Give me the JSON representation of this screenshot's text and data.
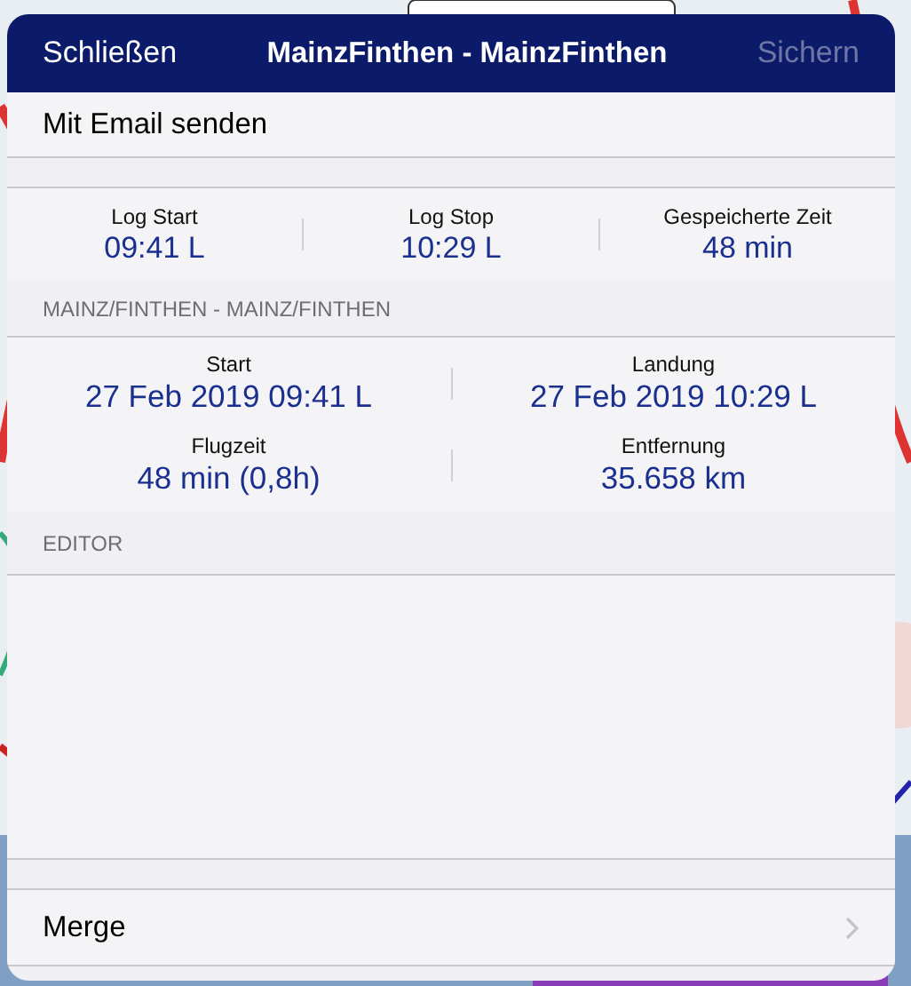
{
  "nav_bar": {
    "left_button": {
      "label": "Schließen",
      "disabled": false
    },
    "title": "MainzFinthen - MainzFinthen",
    "right_button": {
      "label": "Sichern",
      "disabled": true
    }
  },
  "actions": [
    {
      "label": "Mit Email senden"
    }
  ],
  "log_stats": [
    {
      "label": "Log Start",
      "value": "09:41 L"
    },
    {
      "label": "Log Stop",
      "value": "10:29 L"
    },
    {
      "label": "Gespeicherte Zeit",
      "value": "48 min"
    }
  ],
  "route_section": {
    "header": "MAINZ/FINTHEN - MAINZ/FINTHEN",
    "stats": [
      {
        "label": "Start",
        "value": "27 Feb 2019 09:41 L"
      },
      {
        "label": "Landung",
        "value": "27 Feb 2019 10:29 L"
      },
      {
        "label": "Flugzeit",
        "value": "48 min (0,8h)"
      },
      {
        "label": "Entfernung",
        "value": "35.658 km"
      }
    ]
  },
  "editor": {
    "header": "EDITOR"
  },
  "merge_row": {
    "label": "Merge"
  }
}
